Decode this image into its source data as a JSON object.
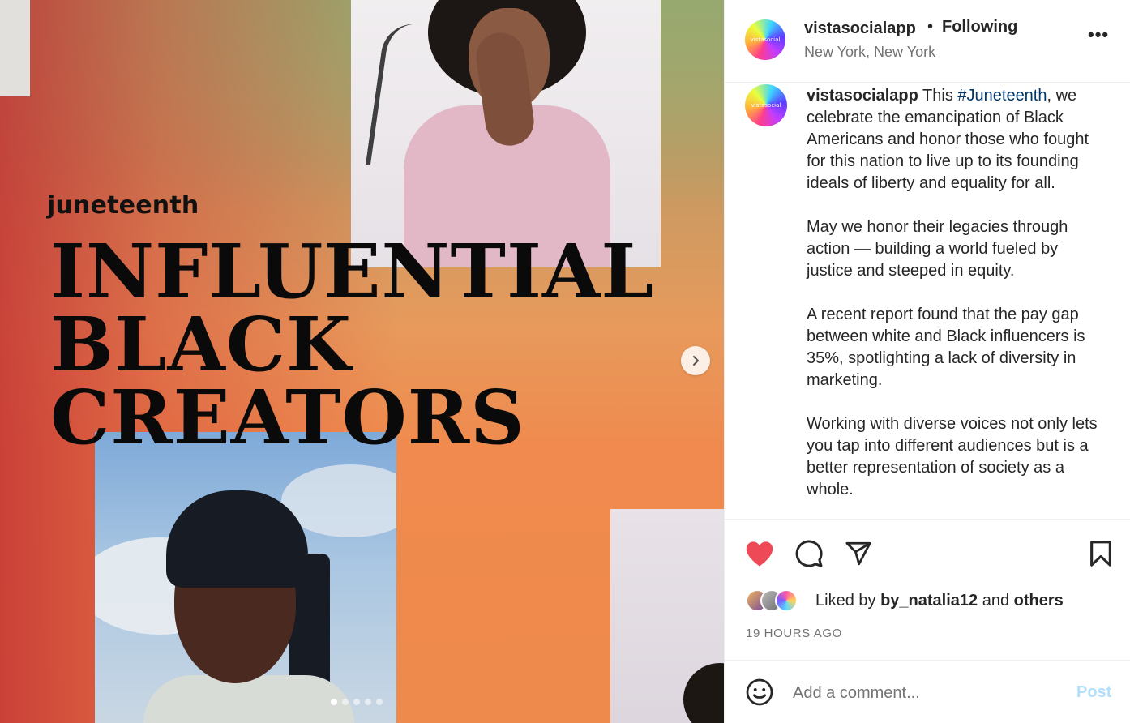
{
  "media": {
    "small_title": "juneteenth",
    "headline": [
      "INFLUENTIAL",
      "BLACK",
      "CREATORS"
    ],
    "dots_total": 5,
    "dots_active": 1
  },
  "header": {
    "username": "vistasocialapp",
    "separator": "•",
    "follow_status": "Following",
    "location": "New York, New York",
    "avatar_text": "vistasocial",
    "more": "•••"
  },
  "caption": {
    "username": "vistasocialapp",
    "pre_hashtag": "This ",
    "hashtag": "#Juneteenth",
    "post_hashtag": ", we celebrate the emancipation of Black Americans and honor those who fought for this nation to live up to its founding ideals of liberty and equality for all.",
    "paragraphs": [
      "May we honor their legacies through action — building a world fueled by justice and steeped in equity.",
      "A recent report found that the pay gap between white and Black influencers is 35%, spotlighting a lack of diversity in marketing.",
      "Working with diverse voices not only lets you tap into different audiences but is a better representation of society as a whole."
    ]
  },
  "likes": {
    "prefix": "Liked by ",
    "user": "by_natalia12",
    "middle": " and ",
    "others": "others"
  },
  "timestamp": "19 HOURS AGO",
  "comment": {
    "placeholder": "Add a comment...",
    "post_label": "Post"
  },
  "colors": {
    "like_red": "#ed4956",
    "hashtag_blue": "#00376b",
    "post_disabled": "#b2dffc"
  }
}
